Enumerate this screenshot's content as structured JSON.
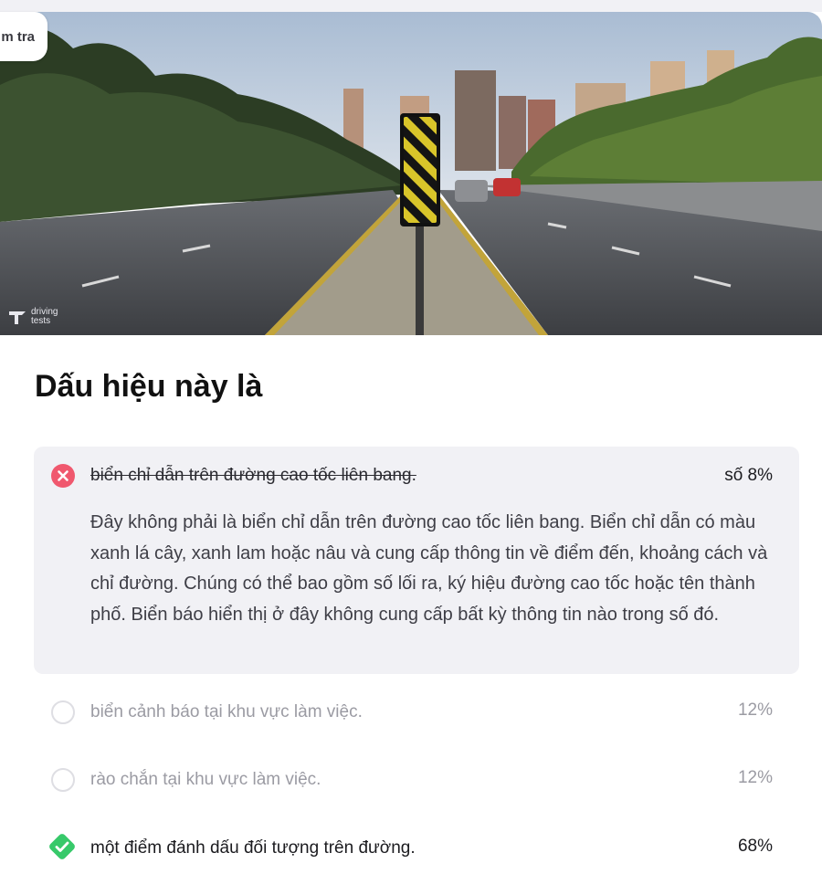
{
  "header": {
    "check_button_label": "m tra"
  },
  "image": {
    "watermark_line1": "driving",
    "watermark_line2": "tests"
  },
  "question": {
    "title": "Dấu hiệu này là"
  },
  "answers": [
    {
      "text": "biển chỉ dẫn trên đường cao tốc liên bang.",
      "percent": "số 8%",
      "state": "wrong",
      "explanation": "Đây không phải là biển chỉ dẫn trên đường cao tốc liên bang. Biển chỉ dẫn có màu xanh lá cây, xanh lam hoặc nâu và cung cấp thông tin về điểm đến, khoảng cách và chỉ đường. Chúng có thể bao gồm số lối ra, ký hiệu đường cao tốc hoặc tên thành phố. Biển báo hiển thị ở đây không cung cấp bất kỳ thông tin nào trong số đó."
    },
    {
      "text": "biển cảnh báo tại khu vực làm việc.",
      "percent": "12%",
      "state": "unselected"
    },
    {
      "text": "rào chắn tại khu vực làm việc.",
      "percent": "12%",
      "state": "unselected"
    },
    {
      "text": "một điểm đánh dấu đối tượng trên đường.",
      "percent": "68%",
      "state": "correct"
    }
  ],
  "colors": {
    "wrong": "#f0586e",
    "correct": "#37c96a",
    "answer_bg": "#f1f1f5"
  },
  "icons": {
    "wrong": "x-circle-icon",
    "correct": "check-diamond-icon",
    "unselected": "empty-circle-icon"
  }
}
